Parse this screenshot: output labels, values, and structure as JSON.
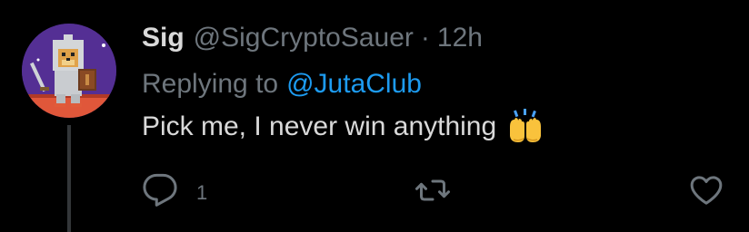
{
  "tweet": {
    "display_name": "Sig",
    "handle": "@SigCryptoSauer",
    "separator": "·",
    "time": "12h",
    "replying_prefix": "Replying to",
    "replying_to": "@JutaClub",
    "text": "Pick me, I never win anything",
    "emoji": "raising-hands-emoji",
    "reply_count": "1"
  },
  "icons": {
    "reply": "speech-bubble-icon",
    "retweet": "retweet-icon",
    "like": "heart-icon"
  },
  "colors": {
    "background": "#000000",
    "text": "#d9d9d9",
    "muted": "#6e767d",
    "link": "#1d9bf0",
    "thread_line": "#333639"
  }
}
